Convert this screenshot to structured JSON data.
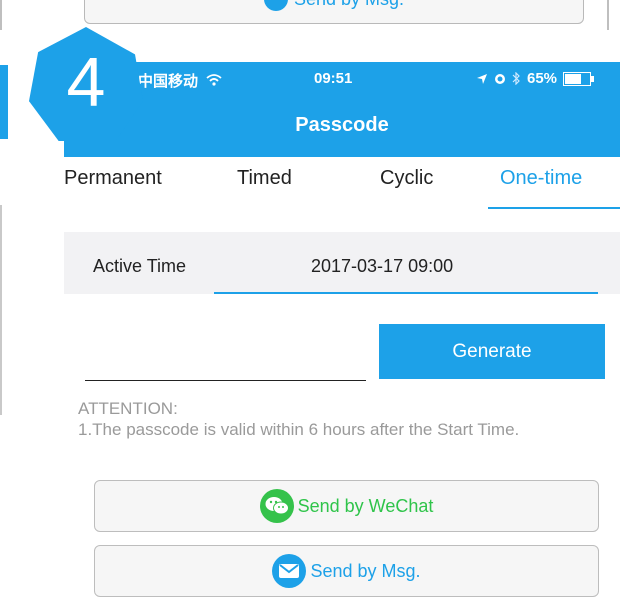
{
  "previous_screen": {
    "send_msg_label": "Send by Msg."
  },
  "step_badge": {
    "number": "4"
  },
  "status_bar": {
    "carrier": "中国移动",
    "time": "09:51",
    "battery": "65%"
  },
  "header": {
    "title": "Passcode"
  },
  "tabs": [
    {
      "label": "Permanent",
      "active": false
    },
    {
      "label": "Timed",
      "active": false
    },
    {
      "label": "Cyclic",
      "active": false
    },
    {
      "label": "One-time",
      "active": true
    }
  ],
  "active_time": {
    "label": "Active Time",
    "value": "2017-03-17 09:00"
  },
  "passcode": {
    "value": ""
  },
  "generate_button": {
    "label": "Generate"
  },
  "attention": {
    "title": "ATTENTION:",
    "text": "1.The passcode is valid within 6 hours after the Start Time."
  },
  "send_buttons": {
    "wechat_label": "Send by WeChat",
    "msg_label": "Send by Msg."
  },
  "colors": {
    "accent": "#1da1e8",
    "wechat": "#35c24b",
    "attention_text": "#9a9a9a"
  }
}
